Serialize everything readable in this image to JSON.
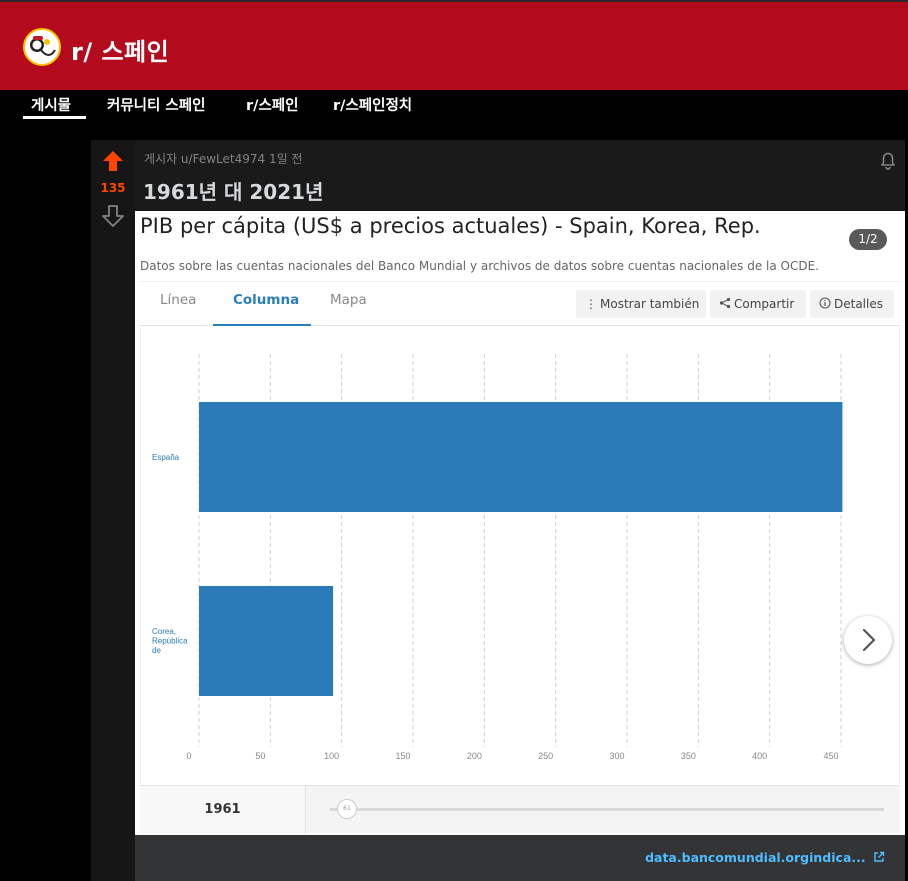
{
  "subreddit": {
    "name": "r/ 스페인"
  },
  "nav": {
    "items": [
      {
        "label": "게시물",
        "active": true
      },
      {
        "label": "커뮤니티 스페인"
      },
      {
        "label": "r/스페인"
      },
      {
        "label": "r/스페인정치"
      }
    ]
  },
  "post": {
    "score": "135",
    "meta": "게시자 u/FewLet4974 1일 전",
    "title": "1961년 대 2021년"
  },
  "embed": {
    "title": "PIB per cápita (US$ a precios actuales) - Spain, Korea, Rep.",
    "pager": "1/2",
    "subtitle": "Datos sobre las cuentas nacionales del Banco Mundial y archivos de datos sobre cuentas nacionales de la OCDE.",
    "tabs": [
      "Línea",
      "Columna",
      "Mapa"
    ],
    "active_tab": "Columna",
    "buttons": {
      "more": "Mostrar también",
      "share": "Compartir",
      "details": "Detalles"
    },
    "year": "1961",
    "slider_value": "61"
  },
  "chart_data": {
    "type": "bar",
    "orientation": "horizontal",
    "categories": [
      "España",
      "Corea, República de"
    ],
    "values": [
      451,
      94
    ],
    "xlim": [
      0,
      450
    ],
    "xticks": [
      0,
      50,
      100,
      150,
      200,
      250,
      300,
      350,
      400,
      450
    ],
    "grid": true,
    "bar_color": "#2b7bb9"
  },
  "link": {
    "text": "data.bancomundial.orgindica..."
  },
  "colors": {
    "header": "#b30a1d",
    "upvote": "#ff4500",
    "link": "#4fbcff",
    "tab_active": "#2b7fb8"
  }
}
